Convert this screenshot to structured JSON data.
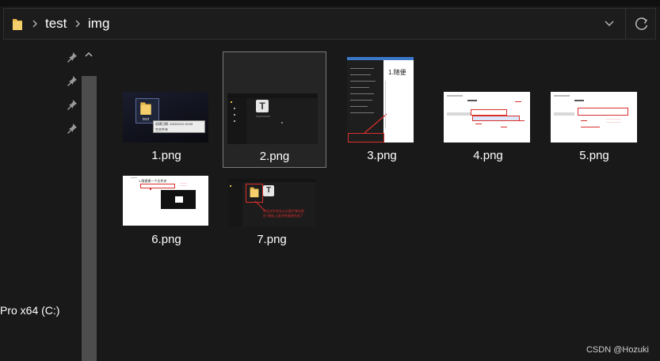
{
  "address": {
    "crumbs": [
      "test",
      "img"
    ]
  },
  "nav": {
    "drive_label": "Pro x64 (C:)"
  },
  "files": [
    {
      "name": "1.png"
    },
    {
      "name": "2.png"
    },
    {
      "name": "3.png"
    },
    {
      "name": "4.png"
    },
    {
      "name": "5.png"
    },
    {
      "name": "6.png"
    },
    {
      "name": "7.png"
    }
  ],
  "thumb_text": {
    "t1_folder": "test",
    "t1_tooltip_line1": "创建日期: 2022/2/12 19:03",
    "t1_tooltip_line2": "空文件夹",
    "t3_heading": "1.随便",
    "t6_heading": "1.随便建一个文件夹",
    "t7_caption_line1": "将这文件夹先从左图片移动到",
    "t7_caption_line2": "在T图标上面并释放就完成了"
  },
  "watermark": "CSDN @Hozuki",
  "colors": {
    "background": "#191919",
    "folder_yellow": "#e8b84a",
    "annotation_red": "#d9302c",
    "scroll_thumb": "#4d4d4d"
  }
}
